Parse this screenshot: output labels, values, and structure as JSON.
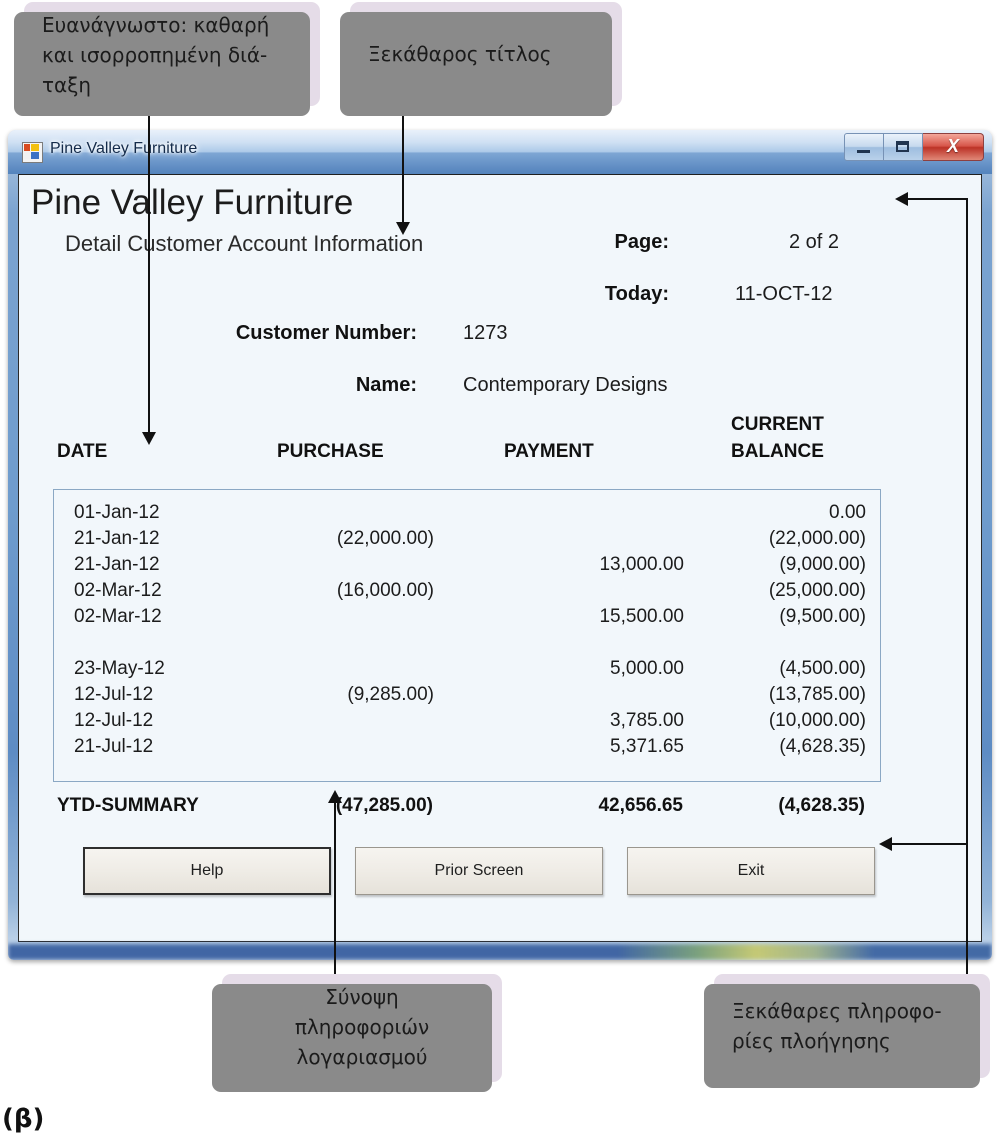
{
  "annotations": {
    "readable": "Ευανάγνωστο: καθαρή και ισορροπημένη διάταξη",
    "readable_lines": [
      "Ευανάγνωστο: καθαρή",
      "και ισορροπημένη διά-",
      "ταξη"
    ],
    "clear_title": "Ξεκάθαρος τίτλος",
    "summary": "Σύνοψη πληροφοριών λογαριασμού",
    "summary_lines": [
      "Σύνοψη",
      "πληροφοριών",
      "λογαριασμού"
    ],
    "navigation": "Ξεκάθαρες πληροφορίες πλοήγησης",
    "navigation_lines": [
      "Ξεκάθαρες πληροφο-",
      "ρίες πλοήγησης"
    ]
  },
  "figure": {
    "caption": "(β)"
  },
  "window": {
    "title": "Pine Valley Furniture",
    "icon": "app-icon",
    "controls": {
      "minimize": "minimize-icon",
      "maximize": "maximize-icon",
      "close": "X"
    }
  },
  "form": {
    "title": "Pine Valley Furniture",
    "subtitle": "Detail Customer Account Information",
    "header_fields": {
      "page_label": "Page:",
      "page_value": "2 of 2",
      "today_label": "Today:",
      "today_value": "11-OCT-12",
      "customer_number_label": "Customer Number:",
      "customer_number_value": "1273",
      "name_label": "Name:",
      "name_value": "Contemporary Designs"
    },
    "columns": {
      "date": "DATE",
      "purchase": "PURCHASE",
      "payment": "PAYMENT",
      "balance_line1": "CURRENT",
      "balance_line2": "BALANCE"
    },
    "rows": [
      {
        "date": "01-Jan-12",
        "purchase": "",
        "payment": "",
        "balance": "0.00"
      },
      {
        "date": "21-Jan-12",
        "purchase": "(22,000.00)",
        "payment": "",
        "balance": "(22,000.00)"
      },
      {
        "date": "21-Jan-12",
        "purchase": "",
        "payment": "13,000.00",
        "balance": "(9,000.00)"
      },
      {
        "date": "02-Mar-12",
        "purchase": "(16,000.00)",
        "payment": "",
        "balance": "(25,000.00)"
      },
      {
        "date": "02-Mar-12",
        "purchase": "",
        "payment": "15,500.00",
        "balance": "(9,500.00)"
      },
      {
        "date": "",
        "purchase": "",
        "payment": "",
        "balance": ""
      },
      {
        "date": "23-May-12",
        "purchase": "",
        "payment": "5,000.00",
        "balance": "(4,500.00)"
      },
      {
        "date": "12-Jul-12",
        "purchase": "(9,285.00)",
        "payment": "",
        "balance": "(13,785.00)"
      },
      {
        "date": "12-Jul-12",
        "purchase": "",
        "payment": "3,785.00",
        "balance": "(10,000.00)"
      },
      {
        "date": "21-Jul-12",
        "purchase": "",
        "payment": "5,371.65",
        "balance": "(4,628.35)"
      }
    ],
    "summary": {
      "label": "YTD-SUMMARY",
      "purchase": "(47,285.00)",
      "payment": "42,656.65",
      "balance": "(4,628.35)"
    },
    "buttons": {
      "help": "Help",
      "prior": "Prior Screen",
      "exit": "Exit"
    }
  },
  "colors": {
    "callout_fill": "#e5dce8",
    "callout_shadow": "#8a8a8a",
    "window_frame": "#6f9ccd",
    "client_bg": "#f2f7fb",
    "grid_border": "#8ba8c4",
    "close_button": "#bc3226"
  }
}
